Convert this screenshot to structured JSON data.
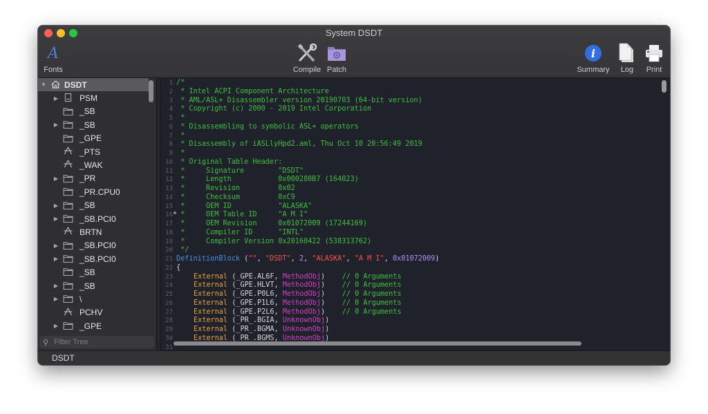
{
  "window": {
    "title": "System DSDT"
  },
  "toolbar": {
    "fonts": "Fonts",
    "compile": "Compile",
    "patch": "Patch",
    "summary": "Summary",
    "log": "Log",
    "print": "Print"
  },
  "tree": {
    "root": "DSDT",
    "items": [
      {
        "label": "PSM"
      },
      {
        "label": "_SB"
      },
      {
        "label": "_SB"
      },
      {
        "label": "_GPE"
      },
      {
        "label": "_PTS"
      },
      {
        "label": "_WAK"
      },
      {
        "label": "_PR"
      },
      {
        "label": "_PR.CPU0"
      },
      {
        "label": "_SB"
      },
      {
        "label": "_SB.PCI0"
      },
      {
        "label": "BRTN"
      },
      {
        "label": "_SB.PCI0"
      },
      {
        "label": "_SB.PCI0"
      },
      {
        "label": "_SB"
      },
      {
        "label": "_SB"
      },
      {
        "label": "\\"
      },
      {
        "label": "PCHV"
      },
      {
        "label": "_GPE"
      }
    ],
    "filter_placeholder": "Filter Tree"
  },
  "editor": {
    "line_numbers": [
      "1",
      "2",
      "3",
      "4",
      "5",
      "6",
      "7",
      "8",
      "9",
      "10",
      "11",
      "12",
      "13",
      "14",
      "15",
      "16",
      "17",
      "18",
      "19",
      "20",
      "21",
      "22",
      "23",
      "24",
      "25",
      "26",
      "27",
      "28",
      "29",
      "30",
      "31"
    ],
    "lines": {
      "l1": "/*",
      "l2": " * Intel ACPI Component Architecture",
      "l3": " * AML/ASL+ Disassembler version 20190703 (64-bit version)",
      "l4": " * Copyright (c) 2000 - 2019 Intel Corporation",
      "l5": " *",
      "l6": " * Disassembling to symbolic ASL+ operators",
      "l7": " *",
      "l8": " * Disassembly of iASLlyHpd2.aml, Thu Oct 10 20:56:49 2019",
      "l9": " *",
      "l10": " * Original Table Header:",
      "l11": " *     Signature        \"DSDT\"",
      "l12": " *     Length           0x000280B7 (164023)",
      "l13": " *     Revision         0x02",
      "l14": " *     Checksum         0xC9",
      "l15": " *     OEM ID           \"ALASKA\"",
      "l16": " *     OEM Table ID     \"A M I\"",
      "l17": " *     OEM Revision     0x01072009 (17244169)",
      "l18": " *     Compiler ID      \"INTL\"",
      "l19": " *     Compiler Version 0x20160422 (538313762)",
      "l20": " */",
      "l21_kw": "DefinitionBlock",
      "l21_p1": " (",
      "l21_s1": "\"\"",
      "l21_c1": ", ",
      "l21_s2": "\"DSDT\"",
      "l21_c2": ", ",
      "l21_n1": "2",
      "l21_c3": ", ",
      "l21_s3": "\"ALASKA\"",
      "l21_c4": ", ",
      "l21_s4": "\"A M I\"",
      "l21_c5": ", ",
      "l21_n2": "0x01072009",
      "l21_p2": ")",
      "l22": "{",
      "ext": [
        {
          "kw": "External",
          "name": " (_GPE.AL6F, ",
          "type": "MethodObj",
          "close": ")",
          "comment": "    // 0 Arguments"
        },
        {
          "kw": "External",
          "name": " (_GPE.HLVT, ",
          "type": "MethodObj",
          "close": ")",
          "comment": "    // 0 Arguments"
        },
        {
          "kw": "External",
          "name": " (_GPE.P0L6, ",
          "type": "MethodObj",
          "close": ")",
          "comment": "    // 0 Arguments"
        },
        {
          "kw": "External",
          "name": " (_GPE.P1L6, ",
          "type": "MethodObj",
          "close": ")",
          "comment": "    // 0 Arguments"
        },
        {
          "kw": "External",
          "name": " (_GPE.P2L6, ",
          "type": "MethodObj",
          "close": ")",
          "comment": "    // 0 Arguments"
        },
        {
          "kw": "External",
          "name": " (_PR_.BGIA, ",
          "type": "UnknownObj",
          "close": ")",
          "comment": ""
        },
        {
          "kw": "External",
          "name": " (_PR_.BGMA, ",
          "type": "UnknownObj",
          "close": ")",
          "comment": ""
        },
        {
          "kw": "External",
          "name": " (_PR_.BGMS, ",
          "type": "UnknownObj",
          "close": ")",
          "comment": ""
        }
      ]
    }
  },
  "status": {
    "text": "DSDT"
  },
  "colors": {
    "comment": "#3fbf3f",
    "keyword": "#4a90e2",
    "string": "#ff4d4d",
    "number": "#b38cff",
    "external": "#e6a23c",
    "objtype": "#d23fc6"
  }
}
